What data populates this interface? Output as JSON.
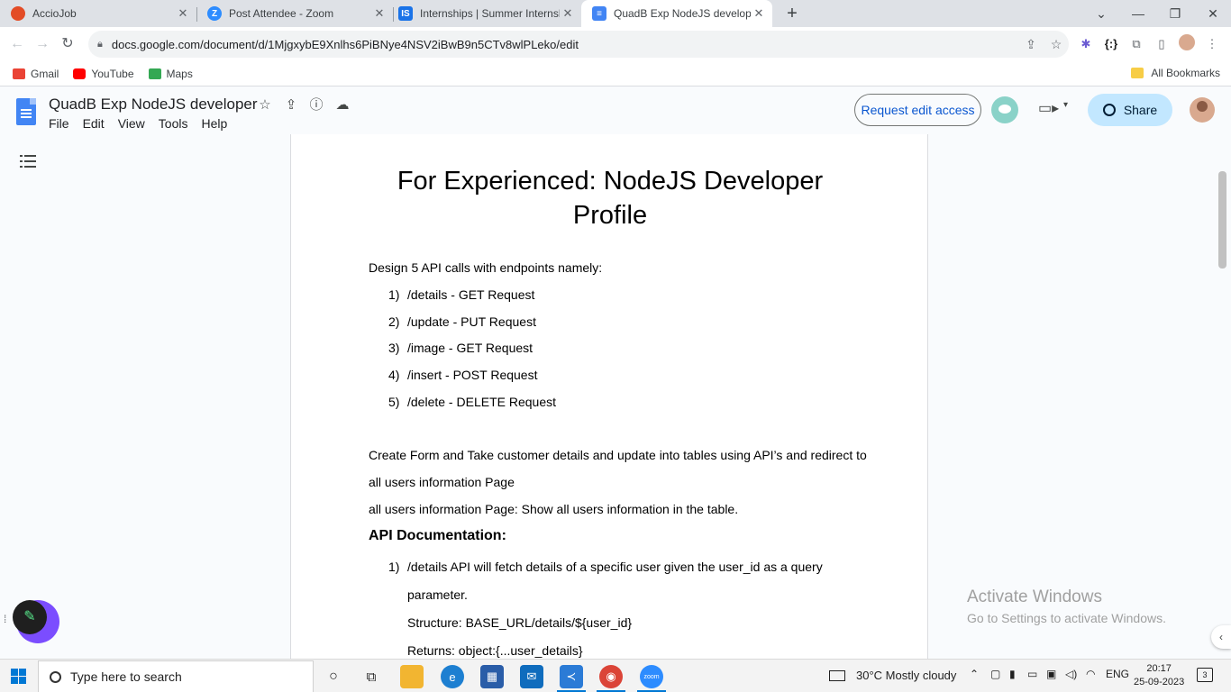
{
  "browser": {
    "tabs": [
      {
        "title": "AccioJob",
        "favicon_color": "#e34c26",
        "active": false
      },
      {
        "title": "Post Attendee - Zoom",
        "favicon_color": "#2d8cff",
        "active": false
      },
      {
        "title": "Internships | Summer Internship",
        "favicon_color": "#1a73e8",
        "active": false
      },
      {
        "title": "QuadB Exp NodeJS developer - G",
        "favicon_color": "#4285f4",
        "active": true
      }
    ],
    "url": "docs.google.com/document/d/1MjgxybE9Xnlhs6PiBNye4NSV2iBwB9n5CTv8wlPLeko/edit",
    "bookmarks": [
      {
        "label": "Gmail",
        "color": "#ea4335"
      },
      {
        "label": "YouTube",
        "color": "#ff0000"
      },
      {
        "label": "Maps",
        "color": "#34a853"
      }
    ],
    "all_bookmarks": "All Bookmarks"
  },
  "docs": {
    "title": "QuadB Exp NodeJS developer",
    "menu": [
      "File",
      "Edit",
      "View",
      "Tools",
      "Help"
    ],
    "request_edit": "Request edit access",
    "share": "Share"
  },
  "document": {
    "heading_line1": "For Experienced: NodeJS Developer",
    "heading_line2": "Profile",
    "intro": "Design 5 API calls with endpoints namely:",
    "endpoints": [
      {
        "num": "1)",
        "path": "/details",
        "method": "GET Request"
      },
      {
        "num": "2)",
        "path": "/update",
        "method": "PUT Request"
      },
      {
        "num": "3)",
        "path": "/image",
        "method": "GET Request"
      },
      {
        "num": "4)",
        "path": "/insert",
        "method": "POST Request"
      },
      {
        "num": "5)",
        "path": "/delete",
        "method": "DELETE Request"
      }
    ],
    "form_line1": "Create Form and Take customer details and update into tables using API’s and redirect to",
    "form_line2": "all users information Page",
    "form_line3": "all users information Page:  Show all users information in the table.",
    "api_doc_heading": "API Documentation:",
    "doc_item_num": "1)",
    "doc_item_line1": "/details API will fetch details of a specific user given the user_id as a query",
    "doc_item_line2": "parameter.",
    "doc_item_structure": "Structure: BASE_URL/details/${user_id}",
    "doc_item_returns": "Returns: object:{...user_details}"
  },
  "watermark": {
    "line1": "Activate Windows",
    "line2": "Go to Settings to activate Windows."
  },
  "taskbar": {
    "search_placeholder": "Type here to search",
    "weather": "30°C  Mostly cloudy",
    "lang": "ENG",
    "time": "20:17",
    "date": "25-09-2023",
    "notifications": "3"
  }
}
